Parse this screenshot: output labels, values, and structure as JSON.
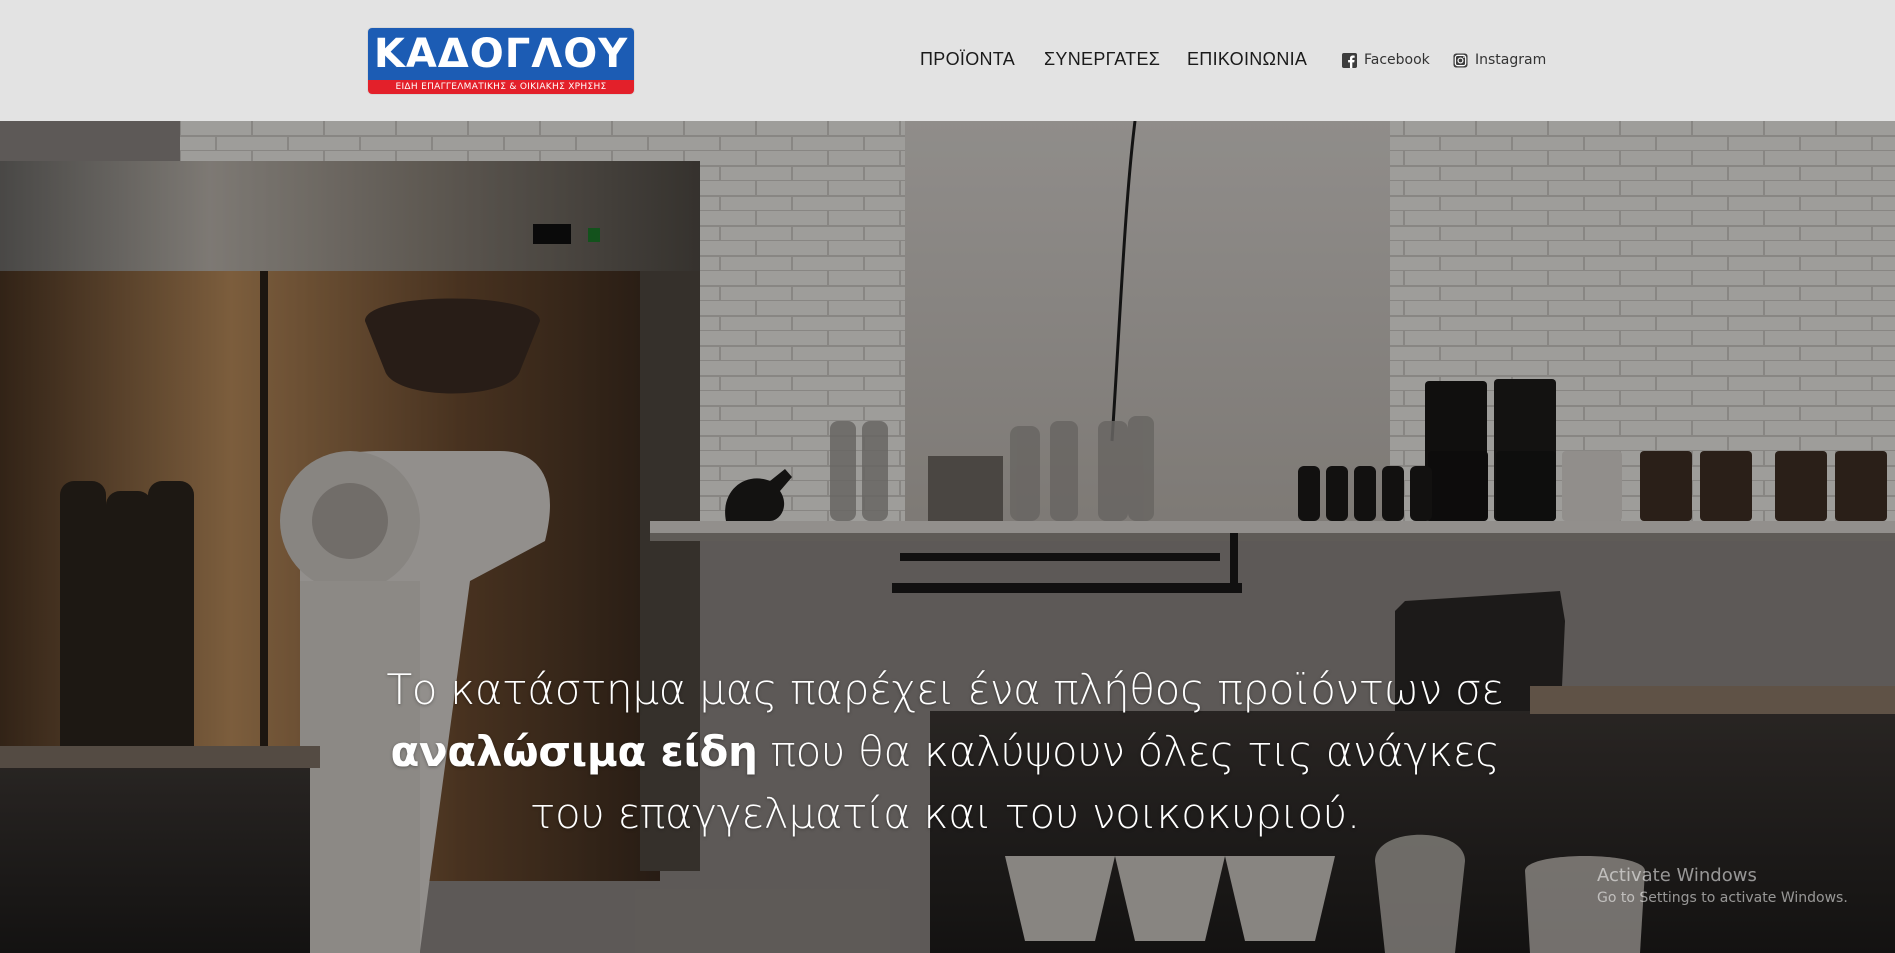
{
  "header": {
    "logo": {
      "title": "ΚΑΔΟΓΛΟΥ",
      "subtitle": "ΕΙΔΗ ΕΠΑΓΓΕΛΜΑΤΙΚΗΣ & ΟΙΚΙΑΚΗΣ ΧΡΗΣΗΣ",
      "colors": {
        "blue": "#1c5cb4",
        "red": "#e3202a"
      }
    },
    "nav": {
      "products": "ΠΡΟΪΟΝΤΑ",
      "partners": "ΣΥΝΕΡΓΑΤΕΣ",
      "contact": "ΕΠΙΚΟΙΝΩΝΙΑ"
    },
    "social": {
      "facebook": {
        "label": "Facebook",
        "icon": "facebook-icon"
      },
      "instagram": {
        "label": "Instagram",
        "icon": "instagram-icon"
      }
    },
    "background": "#e3e3e3"
  },
  "hero": {
    "text": {
      "line1": "Το κατάστημα μας παρέχει ένα πλήθος προϊόντων σε",
      "bold": "αναλώσιμα είδη",
      "line2_rest": " που θα καλύψουν όλες τις ανάγκες",
      "line3": "του επαγγελματία και του νοικοκυριού."
    },
    "image": "dimmed coffee shop / professional kitchen background"
  },
  "system": {
    "activate_windows": {
      "title": "Activate Windows",
      "subtitle": "Go to Settings to activate Windows."
    }
  }
}
